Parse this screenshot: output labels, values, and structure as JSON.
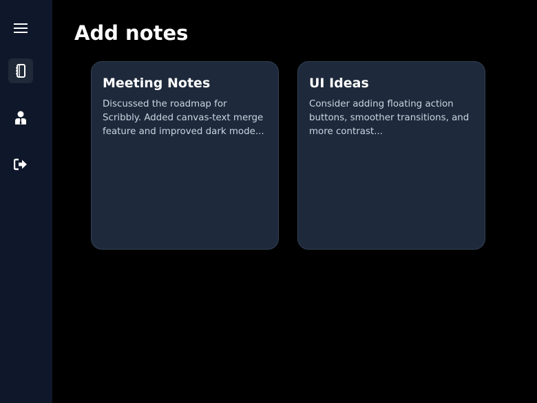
{
  "colors": {
    "page_background": "#000000",
    "sidebar_background": "#0f172a",
    "active_nav_background": "#1f2937",
    "card_background": "#1e293b",
    "card_border": "#334155",
    "title_text": "#ffffff",
    "body_text": "#cbd5e1"
  },
  "sidebar": {
    "items": [
      {
        "icon": "hamburger-menu-icon",
        "active": false
      },
      {
        "icon": "notebook-icon",
        "active": true
      },
      {
        "icon": "user-icon",
        "active": false
      },
      {
        "icon": "logout-icon",
        "active": false
      }
    ]
  },
  "main": {
    "title": "Add notes",
    "notes": [
      {
        "title": "Meeting Notes",
        "body": "Discussed the roadmap for Scribbly. Added canvas-text merge feature and improved dark mode..."
      },
      {
        "title": "UI Ideas",
        "body": "Consider adding floating action buttons, smoother transitions, and more contrast..."
      }
    ]
  }
}
